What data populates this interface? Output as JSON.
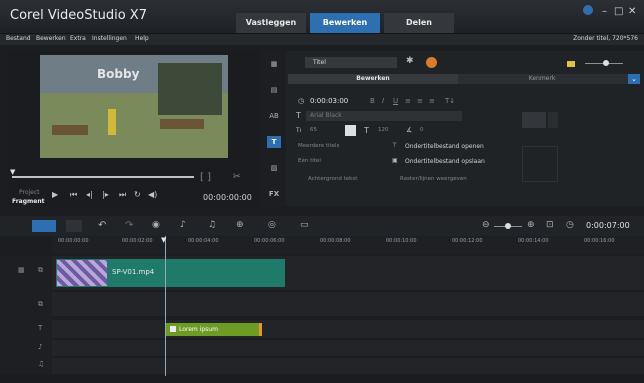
{
  "app": {
    "title": "Corel VideoStudio X7"
  },
  "workspace_tabs": [
    {
      "label": "Vastleggen"
    },
    {
      "label": "Bewerken"
    },
    {
      "label": "Delen"
    }
  ],
  "menu": [
    "Bestand",
    "Bewerken",
    "Extra",
    "Instellingen",
    "Help"
  ],
  "project_info": "Zonder titel, 720*576",
  "preview": {
    "overlay_text": "Bobby",
    "mode_top": "Project",
    "mode_bottom": "Fragment",
    "timecode": "00:00:00:00",
    "bracket": "[ ]"
  },
  "options": {
    "dropdown": "Titel",
    "tab_edit": "Bewerken",
    "tab_attr": "Kenmerk",
    "duration": "0:00:03:00",
    "font": "Arial Black",
    "size": "65",
    "line": "120",
    "angle": "0",
    "text_bg": "Achtergrond tekst",
    "safe_area": "Raster/lijnen weergeven",
    "multi": "Meerdere titels",
    "single": "Eén titel",
    "open_sub": "Ondertitelbestand openen",
    "save_sub": "Ondertitelbestand opslaan"
  },
  "sidebar_icons": [
    "Media",
    "Instant Project",
    "Overgang",
    "Titel",
    "Grafisch",
    "Filter"
  ],
  "timeline": {
    "time_display": "0:00:07:00",
    "ruler": [
      "00:00:00:00",
      "00:00:02:00",
      "00:00:04:00",
      "00:00:06:00",
      "00:00:08:00",
      "00:00:10:00",
      "00:00:12:00",
      "00:00:14:00",
      "00:00:16:00"
    ],
    "video_clip": "SP-V01.mp4",
    "title_clip": "Lorem ipsum"
  },
  "colors": {
    "accent": "#2e6fb2",
    "video_clip": "#1f7a6a",
    "title_clip": "#6e9a26"
  }
}
